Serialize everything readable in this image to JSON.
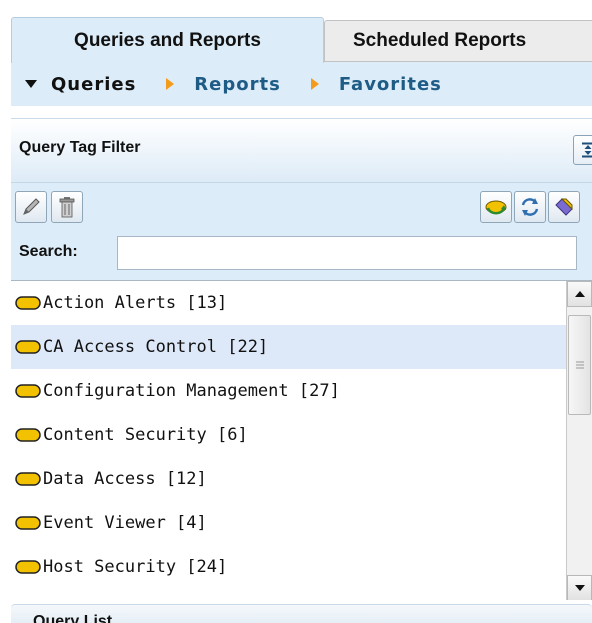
{
  "tabs": [
    {
      "label": "Queries and Reports",
      "active": true
    },
    {
      "label": "Scheduled Reports",
      "active": false
    }
  ],
  "subnav": {
    "queries": "Queries",
    "reports": "Reports",
    "favorites": "Favorites"
  },
  "filter": {
    "title": "Query Tag Filter",
    "collapse_icon": "collapse-panel-icon"
  },
  "toolbar": {
    "left_icons": [
      "edit-pencil-icon",
      "delete-trash-icon"
    ],
    "right_icons": [
      "add-tag-icon",
      "refresh-icon",
      "tag-icon"
    ]
  },
  "search": {
    "label": "Search:",
    "value": "",
    "placeholder": ""
  },
  "tag_list": {
    "items": [
      {
        "label": "Action Alerts [13]",
        "selected": false
      },
      {
        "label": "CA Access Control [22]",
        "selected": true
      },
      {
        "label": "Configuration Management [27]",
        "selected": false
      },
      {
        "label": "Content Security [6]",
        "selected": false
      },
      {
        "label": "Data Access [12]",
        "selected": false
      },
      {
        "label": "Event Viewer [4]",
        "selected": false
      },
      {
        "label": "Host Security [24]",
        "selected": false
      }
    ]
  },
  "next_section": {
    "title": "Query List"
  },
  "colors": {
    "panel_bg": "#dcecf8",
    "link": "#1e5c86",
    "arrow": "#f39c1b",
    "tag_fill": "#f2c200",
    "selected_row": "#dde8f8"
  }
}
